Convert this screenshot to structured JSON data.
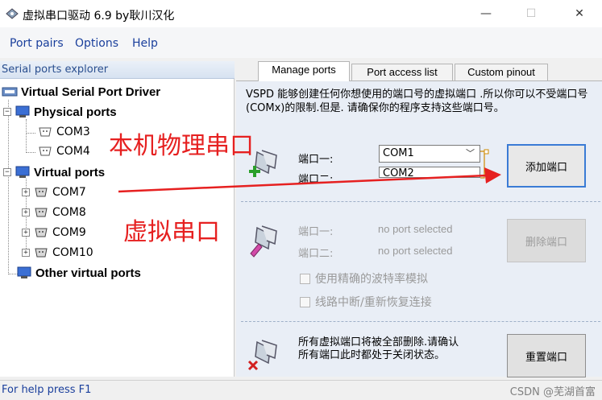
{
  "window": {
    "title": "虚拟串口驱动 6.9 by耿川汉化",
    "minimize": "—",
    "maximize": "☐",
    "close": "✕"
  },
  "menu": {
    "items": [
      "Port pairs",
      "Options",
      "Help"
    ]
  },
  "explorer": {
    "header": "Serial ports explorer",
    "root": "Virtual Serial Port Driver",
    "physical_label": "Physical ports",
    "physical_ports": [
      "COM3",
      "COM4"
    ],
    "virtual_label": "Virtual ports",
    "virtual_ports": [
      "COM7",
      "COM8",
      "COM9",
      "COM10"
    ],
    "other_label": "Other virtual ports"
  },
  "tabs": [
    "Manage ports",
    "Port access list",
    "Custom pinout"
  ],
  "manage": {
    "description": "VSPD 能够创建任何你想使用的端口号的虚拟端口 .所以你可以不受端口号(COMx)的限制.但是. 请确保你的程序支持这些端口号。",
    "add": {
      "port1_label": "端口一:",
      "port2_label": "端口二:",
      "port1_value": "COM1",
      "port2_value": "COM2",
      "button": "添加端口"
    },
    "delete": {
      "port1_label": "端口一:",
      "port2_label": "端口二:",
      "port1_value": "no port selected",
      "port2_value": "no port selected",
      "button": "删除端口",
      "option1": "使用精确的波特率模拟",
      "option2": "线路中断/重新恢复连接"
    },
    "reset": {
      "text": "所有虚拟端口将被全部删除.请确认所有端口此时都处于关闭状态。",
      "button": "重置端口"
    }
  },
  "status": {
    "help": "For help press F1",
    "watermark": "CSDN @芜湖首富"
  },
  "annotations": {
    "physical": "本机物理串口",
    "virtual": "虚拟串口"
  },
  "colors": {
    "annotation": "#e62020",
    "menu_text": "#1a3f9c",
    "primary_border": "#3a7bd5"
  }
}
